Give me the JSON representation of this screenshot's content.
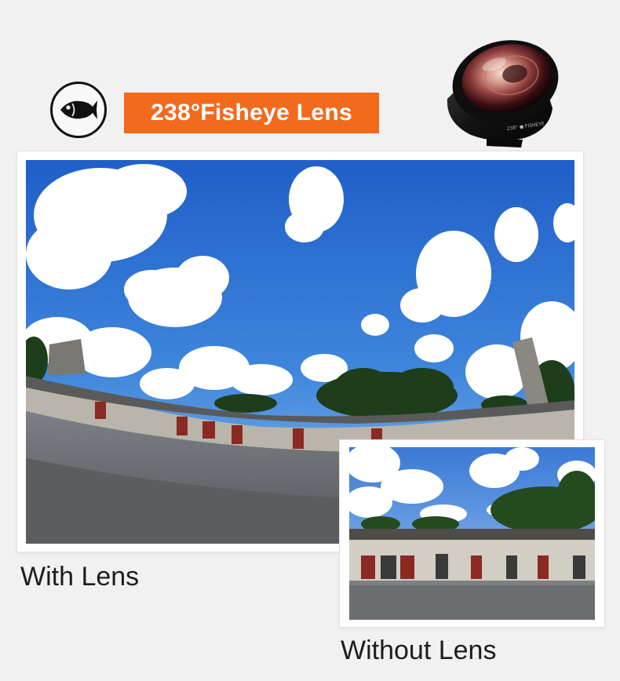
{
  "banner": {
    "title": "238°Fisheye Lens",
    "accent_color": "#f26b1d",
    "icon": "fish-icon"
  },
  "product": {
    "image": "fisheye-lens-photo"
  },
  "photos": {
    "with_lens": {
      "caption": "With Lens",
      "image": "fisheye-village-photo"
    },
    "without_lens": {
      "caption": "Without Lens",
      "image": "normal-village-photo"
    }
  }
}
